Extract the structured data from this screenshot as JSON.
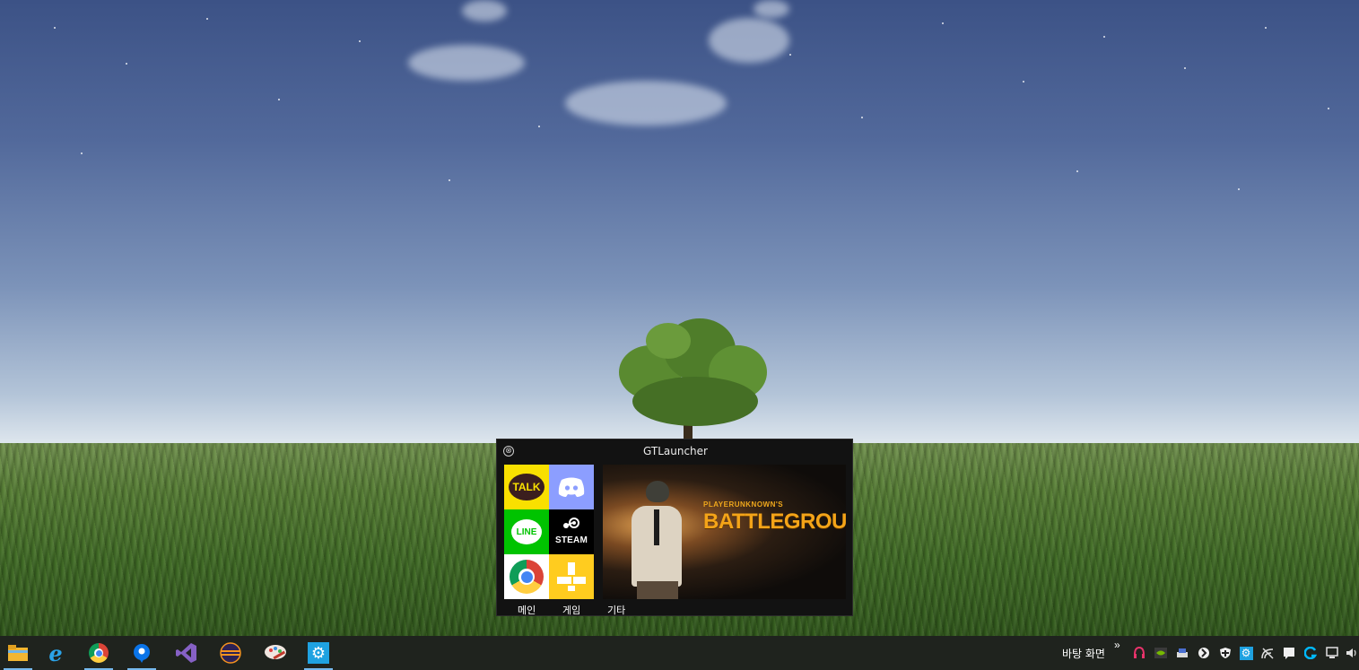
{
  "launcher": {
    "title": "GTLauncher",
    "close_glyph": "⊗",
    "tiles": {
      "kakao": "TALK",
      "line": "LINE",
      "steam": "STEAM"
    },
    "banner": {
      "brand": "PLAYERUNKNOWN'S",
      "title": "BATTLEGROUNDS"
    },
    "tabs": [
      "메인",
      "게임",
      "기타"
    ]
  },
  "taskbar": {
    "desktop_label": "바탕 화면",
    "chevron": "»",
    "apps": [
      "file-explorer-icon",
      "internet-explorer-icon",
      "chrome-icon",
      "maps-icon",
      "visual-studio-icon",
      "eclipse-icon",
      "paint-icon",
      "settings-icon"
    ],
    "tray_icons": [
      "headset-icon",
      "nvidia-icon",
      "printer-icon",
      "app-icon",
      "shield-icon",
      "settings-icon",
      "network-icon",
      "message-icon",
      "logitech-icon",
      "monitor-icon",
      "volume-icon"
    ]
  },
  "colors": {
    "kakao": "#f9e000",
    "discord": "#8c9eff",
    "line": "#00c300",
    "steam": "#000000",
    "accent": "#f4a418",
    "taskbar": "#1f231e"
  }
}
